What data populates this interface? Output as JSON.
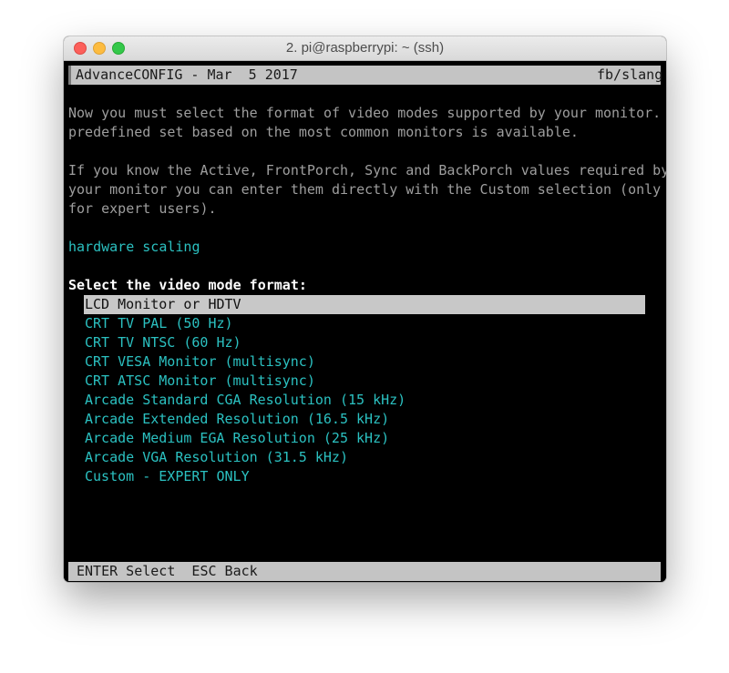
{
  "window": {
    "title": "2. pi@raspberrypi: ~ (ssh)"
  },
  "header": {
    "left": "AdvanceCONFIG - Mar  5 2017",
    "right": "fb/slang"
  },
  "intro": {
    "lines": [
      "Now you must select the format of video modes supported by your monitor. A",
      "predefined set based on the most common monitors is available.",
      "",
      "If you know the Active, FrontPorch, Sync and BackPorch values required by",
      "your monitor you can enter them directly with the Custom selection (only",
      "for expert users)."
    ]
  },
  "status": "hardware scaling",
  "prompt": "Select the video mode format:",
  "options": [
    "LCD Monitor or HDTV",
    "CRT TV PAL (50 Hz)",
    "CRT TV NTSC (60 Hz)",
    "CRT VESA Monitor (multisync)",
    "CRT ATSC Monitor (multisync)",
    "Arcade Standard CGA Resolution (15 kHz)",
    "Arcade Extended Resolution (16.5 kHz)",
    "Arcade Medium EGA Resolution (25 kHz)",
    "Arcade VGA Resolution (31.5 kHz)",
    "Custom - EXPERT ONLY"
  ],
  "selected_option": "LCD Monitor or HDTV",
  "footer": "ENTER Select  ESC Back",
  "colors": {
    "terminal_bg": "#000000",
    "option_text": "#2bc1c1",
    "paragraph_text": "#9e9e9e",
    "bar_bg": "#c4c4c4",
    "close": "#fc605b",
    "minimize": "#fdbc40",
    "maximize": "#34c84a"
  }
}
